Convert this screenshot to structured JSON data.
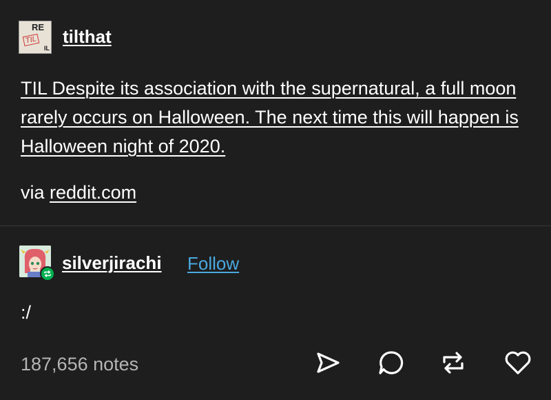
{
  "post": {
    "blog_name": "tilthat",
    "avatar_text": {
      "top": "RE",
      "middle": "TIL",
      "corner": "IL"
    },
    "body": "TIL Despite its association with the supernatural, a full moon rarely occurs on Halloween. The next time this will happen is Halloween night of 2020.",
    "via_prefix": "via",
    "via_link": "reddit.com"
  },
  "reblog": {
    "username": "silverjirachi",
    "follow_label": "Follow",
    "comment": ":/"
  },
  "footer": {
    "notes": "187,656 notes",
    "actions": [
      "share-icon",
      "reply-icon",
      "reblog-icon",
      "like-icon"
    ]
  },
  "colors": {
    "background": "#1e1e1e",
    "text": "#ffffff",
    "muted": "#b5b5b5",
    "follow": "#4aa8e0",
    "reblog_badge": "#00b050"
  }
}
